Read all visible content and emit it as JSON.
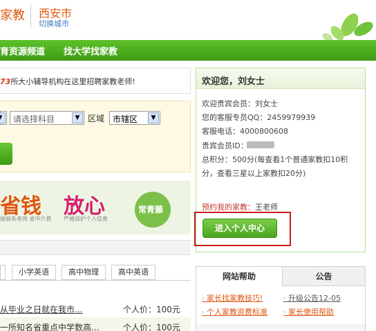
{
  "header": {
    "logo_fragment": "家教",
    "city": "西安市",
    "switch_city": "切换城市"
  },
  "nav": {
    "items": [
      "育资源频道",
      "找大学找家教"
    ]
  },
  "banner": {
    "number": "73",
    "text": "所大小辅导机构在这里招聘家教老师!"
  },
  "search": {
    "subject_placeholder": "请选择科目",
    "area_label": "区域",
    "area_value": "市辖区",
    "dropdown_glyph": "▼"
  },
  "promo": {
    "word_1": "省钱",
    "sub_1": "接联系老师 省中介费",
    "word_2": "放心",
    "sub_2": "严格保护个人信息",
    "badge": "常青藤"
  },
  "tabs": [
    "小学英语",
    "高中物理",
    "高中英语"
  ],
  "listings": [
    {
      "title": "从毕业之日就在我市...",
      "price": "个人价：100元"
    },
    {
      "title": "一所知名省重点中学数高...",
      "price": "个人价：100元"
    }
  ],
  "welcome": {
    "title": "欢迎您，刘女士",
    "line_member": "欢迎贵宾会员：刘女士",
    "line_qq": "您的客服专员QQ：2459979939",
    "line_phone": "客服电话：4000800608",
    "line_id": "贵宾会员ID：",
    "line_points_1": "总积分：500分(每查看1个普通家教扣10积",
    "line_points_2": "分，查看三星以上家教扣20分)",
    "booked_label": "预约我的家教：",
    "booked_value": "王老师",
    "center_button": "进入个人中心"
  },
  "help": {
    "tab_help": "网站帮助",
    "tab_notice": "公告",
    "left_links": [
      "· 家长找家教技巧!",
      "· 个人家教资费标准"
    ],
    "right_links": [
      "· 升级公告12-05",
      "· 家长使用帮助"
    ]
  },
  "colors": {
    "brand_green": "#3d9a14",
    "accent_orange": "#e0560e",
    "highlight_red": "#cc1a1a"
  }
}
